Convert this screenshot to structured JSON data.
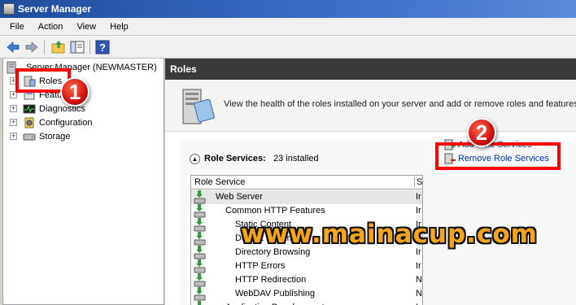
{
  "window": {
    "title": "Server Manager"
  },
  "menu": {
    "items": [
      "File",
      "Action",
      "View",
      "Help"
    ]
  },
  "tree": {
    "root": "Server Manager (NEWMASTER)",
    "items": [
      {
        "label": "Roles",
        "icon": "roles-icon"
      },
      {
        "label": "Features",
        "icon": "features-icon"
      },
      {
        "label": "Diagnostics",
        "icon": "diagnostics-icon"
      },
      {
        "label": "Configuration",
        "icon": "configuration-icon"
      },
      {
        "label": "Storage",
        "icon": "storage-icon"
      }
    ]
  },
  "main": {
    "header": "Roles",
    "summary": "View the health of the roles installed on your server and add or remove roles and features",
    "section": {
      "title": "Role Services:",
      "count": "23 installed"
    },
    "grid": {
      "columns": [
        "Role Service",
        "S"
      ],
      "rows": [
        {
          "name": "Web Server",
          "status": "Ir"
        },
        {
          "name": "Common HTTP Features",
          "status": "Ir"
        },
        {
          "name": "Static Content",
          "status": "Ir"
        },
        {
          "name": "Default Document",
          "status": "Ir"
        },
        {
          "name": "Directory Browsing",
          "status": "Ir"
        },
        {
          "name": "HTTP Errors",
          "status": "Ir"
        },
        {
          "name": "HTTP Redirection",
          "status": "N"
        },
        {
          "name": "WebDAV Publishing",
          "status": "N"
        },
        {
          "name": "Application Development",
          "status": "Ir"
        }
      ]
    },
    "actions": [
      "Add Role Services",
      "Remove Role Services"
    ]
  },
  "annotations": {
    "badge1": "1",
    "badge2": "2",
    "watermark": "www.mainacup.com"
  },
  "colors": {
    "accent": "#ff0000",
    "link": "#0033aa",
    "header": "#3b3b3b",
    "watermark": "#f6a41a"
  }
}
